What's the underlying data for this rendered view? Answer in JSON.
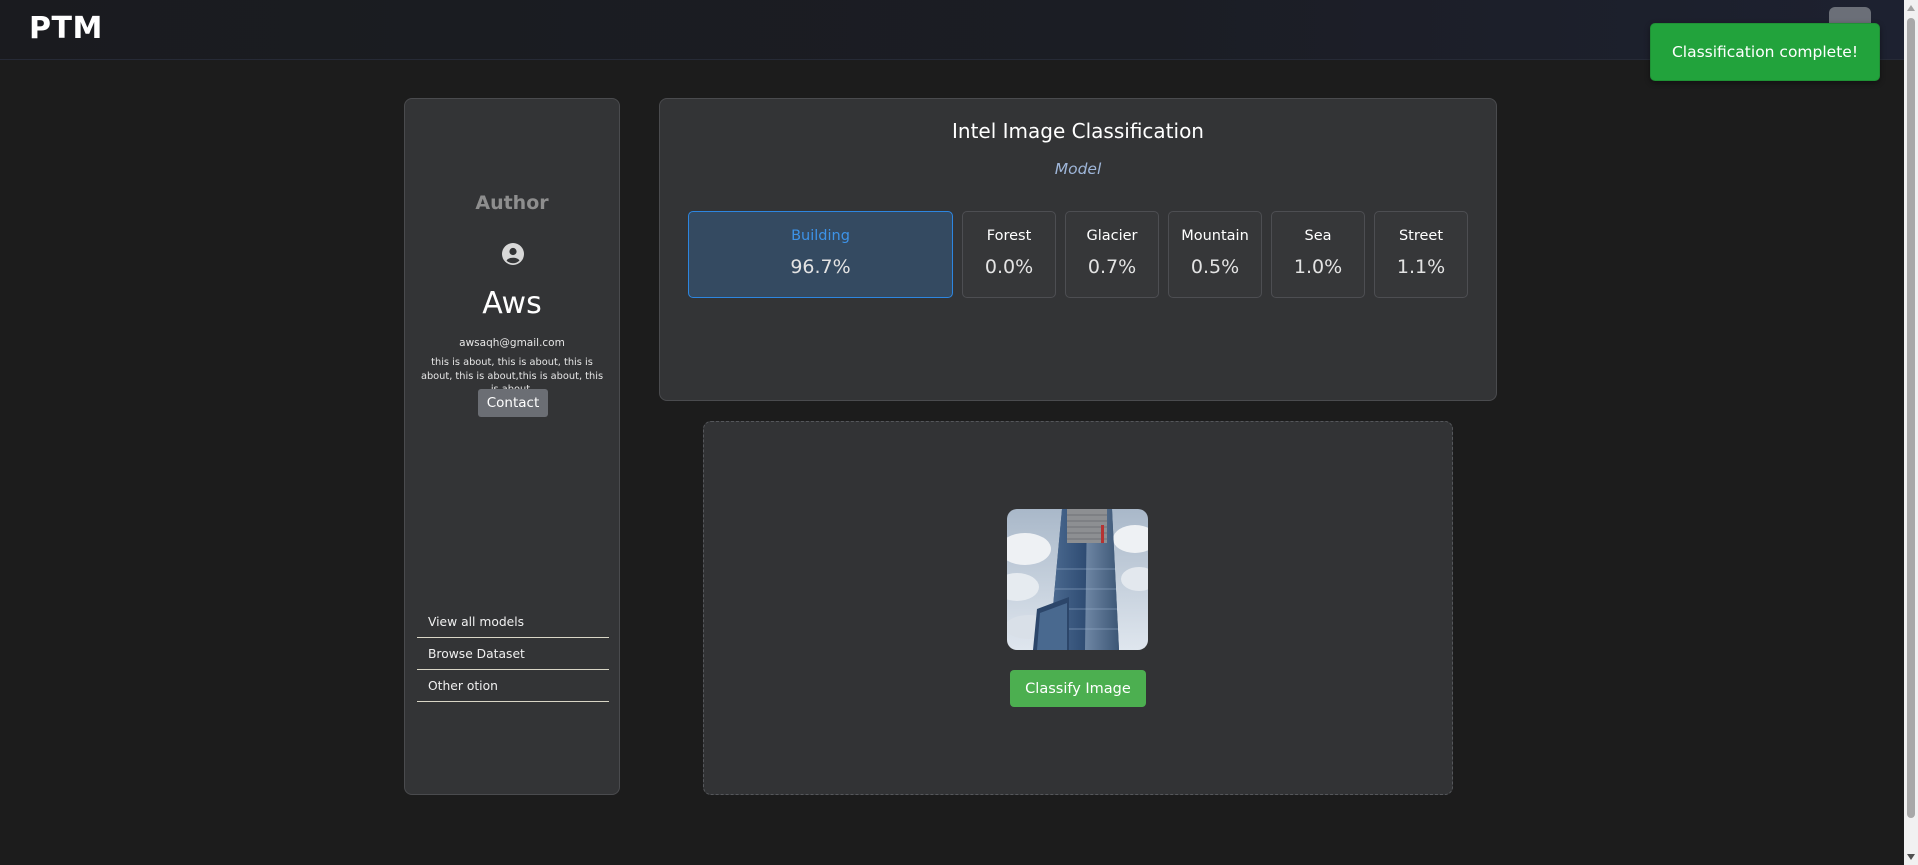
{
  "header": {
    "brand": "PTM"
  },
  "toast": {
    "message": "Classification complete!"
  },
  "sidebar": {
    "heading": "Author",
    "name": "Aws",
    "email": "awsaqh@gmail.com",
    "about": "this is about, this is about, this is about, this is about,this is about, this is about.",
    "contact_label": "Contact",
    "menu": [
      {
        "label": "View all models"
      },
      {
        "label": "Browse Dataset"
      },
      {
        "label": "Other otion"
      }
    ]
  },
  "classification": {
    "title": "Intel Image Classification",
    "subtitle": "Model",
    "results": [
      {
        "label": "Building",
        "value": "96.7%",
        "active": true
      },
      {
        "label": "Forest",
        "value": "0.0%",
        "active": false
      },
      {
        "label": "Glacier",
        "value": "0.7%",
        "active": false
      },
      {
        "label": "Mountain",
        "value": "0.5%",
        "active": false
      },
      {
        "label": "Sea",
        "value": "1.0%",
        "active": false
      },
      {
        "label": "Street",
        "value": "1.1%",
        "active": false
      }
    ]
  },
  "upload": {
    "classify_label": "Classify Image"
  },
  "colors": {
    "accent_blue": "#2d86e0",
    "success_green": "#22a33c",
    "button_green": "#4caf50"
  }
}
